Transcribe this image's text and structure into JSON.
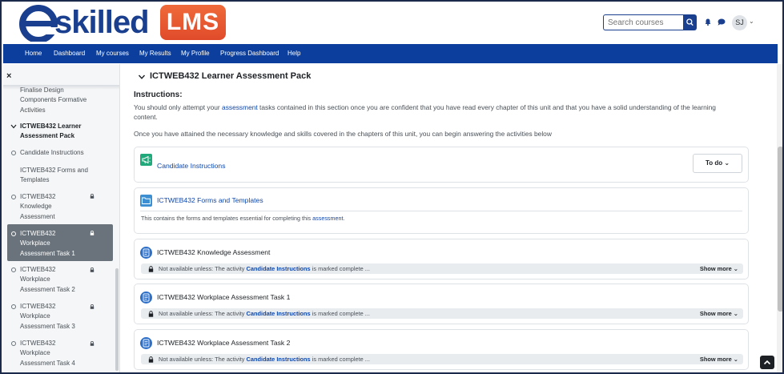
{
  "header": {
    "logo_text": "skilled",
    "logo_badge": "LMS",
    "search_placeholder": "Search courses",
    "avatar_initials": "SJ",
    "colors": {
      "brand_blue": "#1a3f8e",
      "nav_blue": "#0c3f9d",
      "badge_orange": "#e9592f"
    }
  },
  "nav": {
    "items": [
      "Home",
      "Dashboard",
      "My courses",
      "My Results",
      "My Profile",
      "Progress Dashboard",
      "Help"
    ]
  },
  "sidebar": {
    "close_icon": "×",
    "items": [
      {
        "lines": [
          "Finalise Design",
          "Components Formative",
          "Activities"
        ]
      },
      {
        "lines": [
          "ICTWEB432 Learner",
          "Assessment Pack"
        ]
      },
      {
        "lines": [
          "Candidate Instructions"
        ]
      },
      {
        "lines": [
          "ICTWEB432 Forms and",
          "Templates"
        ]
      },
      {
        "lines": [
          "ICTWEB432",
          "Knowledge",
          "Assessment"
        ]
      },
      {
        "lines": [
          "ICTWEB432",
          "Workplace",
          "Assessment Task 1"
        ]
      },
      {
        "lines": [
          "ICTWEB432",
          "Workplace",
          "Assessment Task 2"
        ]
      },
      {
        "lines": [
          "ICTWEB432",
          "Workplace",
          "Assessment Task 3"
        ]
      },
      {
        "lines": [
          "ICTWEB432",
          "Workplace",
          "Assessment Task 4"
        ]
      }
    ]
  },
  "main": {
    "section_title": "ICTWEB432 Learner Assessment Pack",
    "instructions_heading": "Instructions:",
    "para1_a": "You should only attempt your ",
    "para1_link": "assessment",
    "para1_b": " tasks contained in this section once you are confident that you have read every chapter of this unit and that you have a solid understanding of the learning",
    "para1_c": "content.",
    "para2": "Once you have attained the necessary knowledge and skills covered in the chapters of this unit, you can begin answering the activities below",
    "activities": {
      "candidate": {
        "name": "Candidate Instructions",
        "todo": "To do"
      },
      "forms": {
        "name": "ICTWEB432 Forms and Templates",
        "desc_a": "This contains the forms and templates essential for completing this ",
        "desc_link": "assessment",
        "desc_b": "."
      },
      "knowledge": {
        "name": "ICTWEB432 Knowledge Assessment"
      },
      "task1": {
        "name": "ICTWEB432 Workplace Assessment Task 1"
      },
      "task2": {
        "name": "ICTWEB432 Workplace Assessment Task 2"
      }
    },
    "restriction": {
      "prefix": "Not available unless: The activity ",
      "activity": "Candidate Instructions",
      "suffix": " is marked complete ...",
      "show_more": "Show more"
    }
  }
}
